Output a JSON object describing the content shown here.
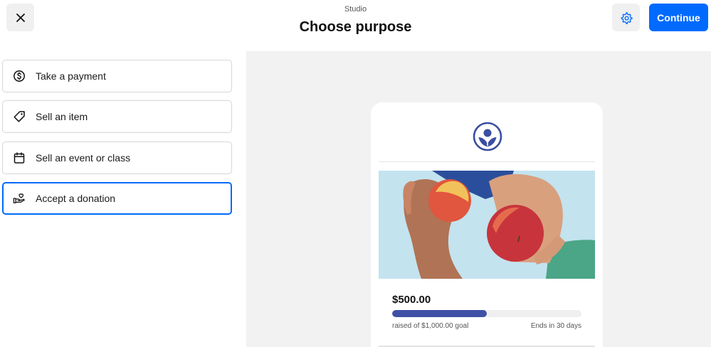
{
  "header": {
    "subtitle": "Studio",
    "title": "Choose purpose",
    "continue_label": "Continue",
    "close_icon": "close-icon",
    "settings_icon": "gear-icon"
  },
  "options": [
    {
      "label": "Take a payment",
      "icon": "dollar-circle-icon",
      "selected": false
    },
    {
      "label": "Sell an item",
      "icon": "tag-icon",
      "selected": false
    },
    {
      "label": "Sell an event or class",
      "icon": "calendar-icon",
      "selected": false
    },
    {
      "label": "Accept a donation",
      "icon": "donation-hand-icon",
      "selected": true
    }
  ],
  "preview": {
    "amount": "$500.00",
    "raised_text": "raised of $1,000.00 goal",
    "ends_text": "Ends in 30 days",
    "progress_fraction": 0.5,
    "image_subject": "hands holding apples"
  },
  "colors": {
    "accent": "#006aff",
    "progress": "#3f51a6",
    "logo": "#3a4fa0",
    "preview_background": "#f2f2f2"
  }
}
